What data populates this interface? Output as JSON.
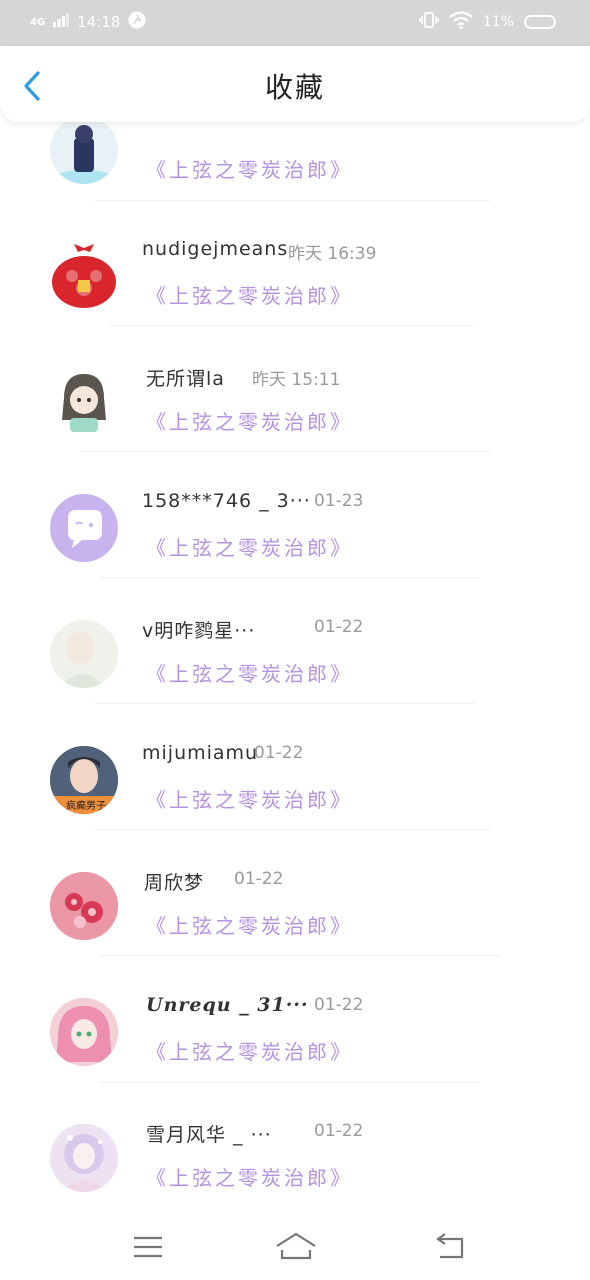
{
  "status_bar": {
    "network": "4G",
    "time": "14:18",
    "battery_pct": "11%"
  },
  "header": {
    "title": "收藏",
    "back_icon": "chevron-left-icon"
  },
  "items": [
    {
      "name": "",
      "time": "",
      "subtitle": "《上弦之零炭治郎》"
    },
    {
      "name": "nudigejmeans",
      "time": "昨天  16:39",
      "subtitle": "《上弦之零炭治郎》"
    },
    {
      "name": "无所谓la",
      "time": "昨天  15:11",
      "subtitle": "《上弦之零炭治郎》"
    },
    {
      "name": "158***746 _ 3···",
      "time": "01-23",
      "subtitle": "《上弦之零炭治郎》"
    },
    {
      "name": "v明咋鹨星···",
      "time": "01-22",
      "subtitle": "《上弦之零炭治郎》"
    },
    {
      "name": "mijumiamu",
      "time": "01-22",
      "subtitle": "《上弦之零炭治郎》",
      "avatar_text": "疯癫男子"
    },
    {
      "name": "周欣梦",
      "time": "01-22",
      "subtitle": "《上弦之零炭治郎》"
    },
    {
      "name": "Unrequ _ 31···",
      "time": "01-22",
      "subtitle": "《上弦之零炭治郎》"
    },
    {
      "name": "雪月风华 _ ···",
      "time": "01-22",
      "subtitle": "《上弦之零炭治郎》"
    }
  ],
  "nav": {
    "menu_icon": "menu-icon",
    "home_icon": "home-icon",
    "back_icon": "back-arrow-icon"
  },
  "colors": {
    "accent_blue": "#2f9be6",
    "subtitle_purple": "#b592e2",
    "status_bar_bg": "#d6d6d6"
  }
}
